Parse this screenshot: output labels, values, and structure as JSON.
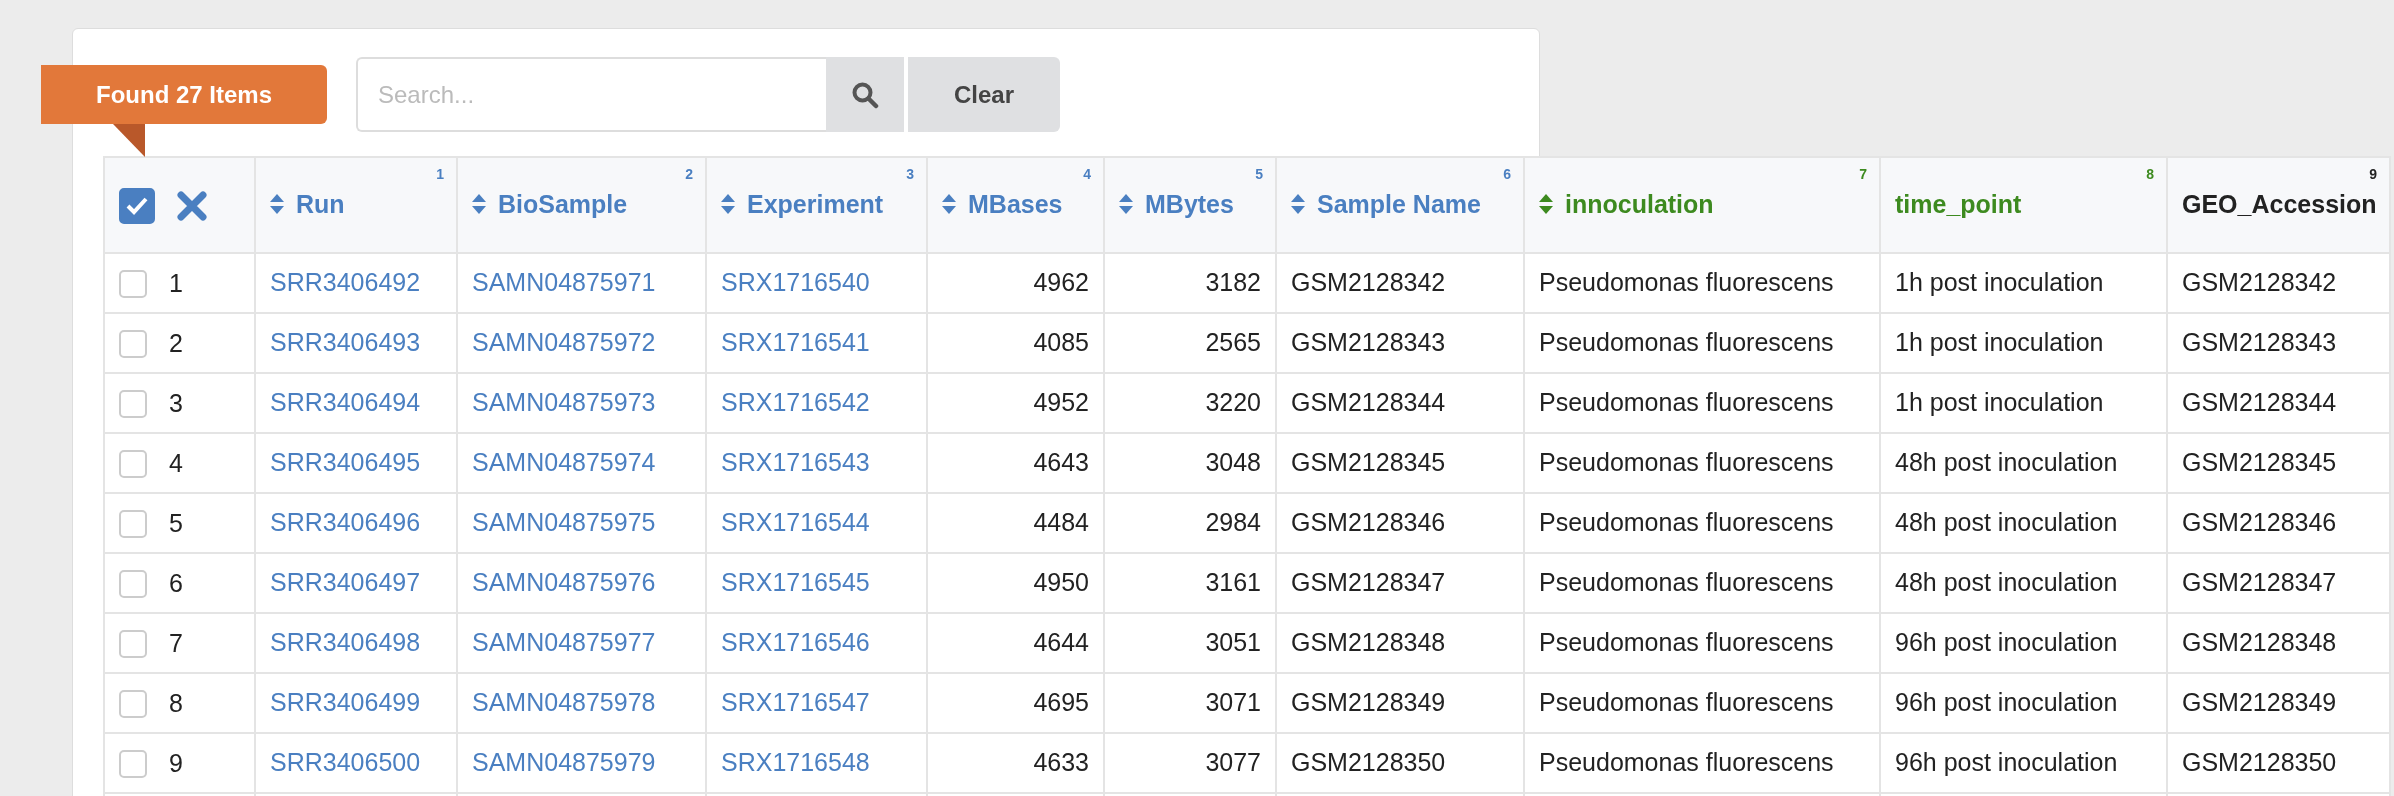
{
  "badge": "Found 27 Items",
  "search": {
    "placeholder": "Search...",
    "clear_button": "Clear"
  },
  "select_all": {
    "checked": true
  },
  "columns": [
    {
      "label": "Run",
      "index": "1",
      "sortable": true,
      "color": "#4a7fc1",
      "kind": "link"
    },
    {
      "label": "BioSample",
      "index": "2",
      "sortable": true,
      "color": "#4a7fc1",
      "kind": "link"
    },
    {
      "label": "Experiment",
      "index": "3",
      "sortable": true,
      "color": "#4a7fc1",
      "kind": "link"
    },
    {
      "label": "MBases",
      "index": "4",
      "sortable": true,
      "color": "#4a7fc1",
      "kind": "number"
    },
    {
      "label": "MBytes",
      "index": "5",
      "sortable": true,
      "color": "#4a7fc1",
      "kind": "number"
    },
    {
      "label": "Sample Name",
      "index": "6",
      "sortable": true,
      "color": "#4a7fc1",
      "kind": "text"
    },
    {
      "label": "innoculation",
      "index": "7",
      "sortable": true,
      "color": "#3d8a1f",
      "kind": "text"
    },
    {
      "label": "time_point",
      "index": "8",
      "sortable": false,
      "color": "#3d8a1f",
      "kind": "text"
    },
    {
      "label": "GEO_Accession",
      "index": "9",
      "sortable": false,
      "color": "#222222",
      "kind": "text"
    }
  ],
  "rows": [
    {
      "number": "1",
      "checked": false,
      "cells": [
        "SRR3406492",
        "SAMN04875971",
        "SRX1716540",
        "4962",
        "3182",
        "GSM2128342",
        "Pseudomonas fluorescens",
        "1h post inoculation",
        "GSM2128342"
      ]
    },
    {
      "number": "2",
      "checked": false,
      "cells": [
        "SRR3406493",
        "SAMN04875972",
        "SRX1716541",
        "4085",
        "2565",
        "GSM2128343",
        "Pseudomonas fluorescens",
        "1h post inoculation",
        "GSM2128343"
      ]
    },
    {
      "number": "3",
      "checked": false,
      "cells": [
        "SRR3406494",
        "SAMN04875973",
        "SRX1716542",
        "4952",
        "3220",
        "GSM2128344",
        "Pseudomonas fluorescens",
        "1h post inoculation",
        "GSM2128344"
      ]
    },
    {
      "number": "4",
      "checked": false,
      "cells": [
        "SRR3406495",
        "SAMN04875974",
        "SRX1716543",
        "4643",
        "3048",
        "GSM2128345",
        "Pseudomonas fluorescens",
        "48h post inoculation",
        "GSM2128345"
      ]
    },
    {
      "number": "5",
      "checked": false,
      "cells": [
        "SRR3406496",
        "SAMN04875975",
        "SRX1716544",
        "4484",
        "2984",
        "GSM2128346",
        "Pseudomonas fluorescens",
        "48h post inoculation",
        "GSM2128346"
      ]
    },
    {
      "number": "6",
      "checked": false,
      "cells": [
        "SRR3406497",
        "SAMN04875976",
        "SRX1716545",
        "4950",
        "3161",
        "GSM2128347",
        "Pseudomonas fluorescens",
        "48h post inoculation",
        "GSM2128347"
      ]
    },
    {
      "number": "7",
      "checked": false,
      "cells": [
        "SRR3406498",
        "SAMN04875977",
        "SRX1716546",
        "4644",
        "3051",
        "GSM2128348",
        "Pseudomonas fluorescens",
        "96h post inoculation",
        "GSM2128348"
      ]
    },
    {
      "number": "8",
      "checked": false,
      "cells": [
        "SRR3406499",
        "SAMN04875978",
        "SRX1716547",
        "4695",
        "3071",
        "GSM2128349",
        "Pseudomonas fluorescens",
        "96h post inoculation",
        "GSM2128349"
      ]
    },
    {
      "number": "9",
      "checked": false,
      "cells": [
        "SRR3406500",
        "SAMN04875979",
        "SRX1716548",
        "4633",
        "3077",
        "GSM2128350",
        "Pseudomonas fluorescens",
        "96h post inoculation",
        "GSM2128350"
      ]
    }
  ]
}
